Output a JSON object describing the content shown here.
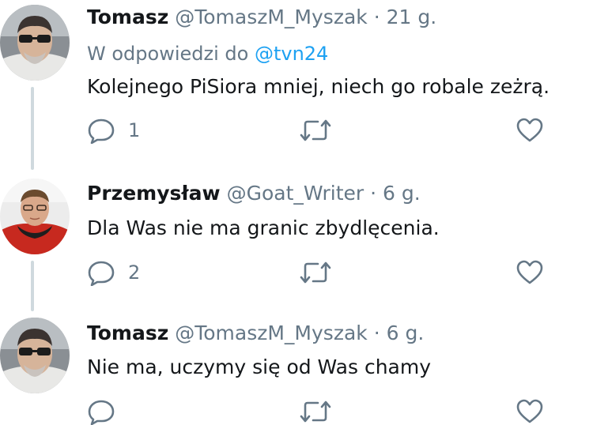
{
  "tweets": [
    {
      "name": "Tomasz",
      "handle": "@TomaszM_Myszak",
      "separator": "·",
      "time": "21 g.",
      "reply_prefix": "W odpowiedzi do",
      "reply_mention": "@tvn24",
      "text": "Kolejnego PiSiora mniej, niech go robale zeżrą.",
      "reply_count": "1",
      "avatar": "man-sunglasses-avatar"
    },
    {
      "name": "Przemysław",
      "handle": "@Goat_Writer",
      "separator": "·",
      "time": "6 g.",
      "text": "Dla Was nie ma granic zbydlęcenia.",
      "reply_count": "2",
      "avatar": "man-red-jacket-avatar"
    },
    {
      "name": "Tomasz",
      "handle": "@TomaszM_Myszak",
      "separator": "·",
      "time": "6 g.",
      "text": "Nie ma, uczymy się od Was chamy",
      "avatar": "man-sunglasses-avatar"
    }
  ],
  "colors": {
    "name": "#14171a",
    "muted": "#657786",
    "link": "#1da1f2",
    "thread_line": "#cfd9de"
  },
  "icons": [
    "comment-icon",
    "retweet-icon",
    "like-icon"
  ]
}
